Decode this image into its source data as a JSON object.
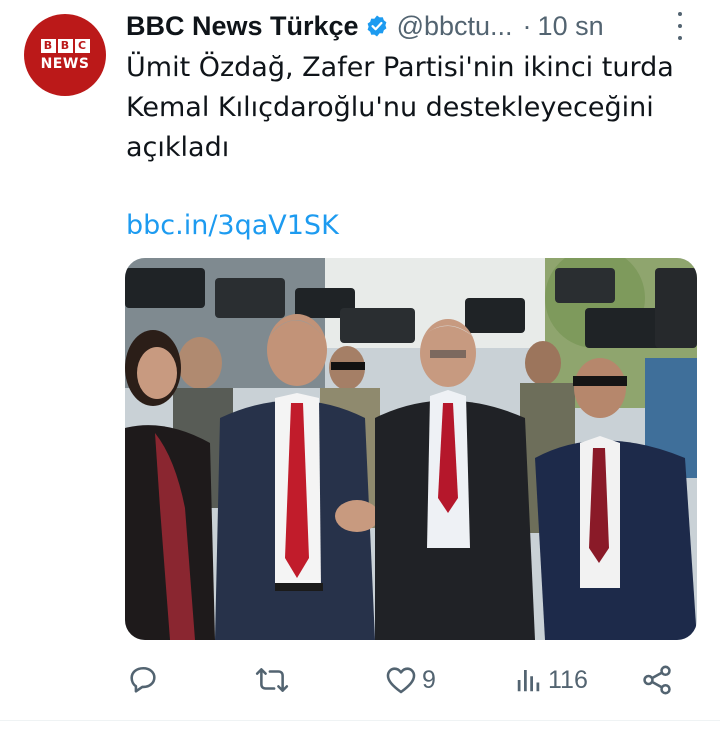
{
  "account": {
    "avatar_text_top": [
      "B",
      "B",
      "C"
    ],
    "avatar_text_bottom": "NEWS",
    "display_name": "BBC News Türkçe",
    "handle": "@bbctu...",
    "separator": "·",
    "time": "10 sn",
    "verified": true
  },
  "tweet": {
    "text": "Ümit Özdağ, Zafer Partisi'nin ikinci turda Kemal Kılıçdaroğlu'nu destekleyeceğini açıkladı",
    "link": "bbc.in/3qaV1SK"
  },
  "media": {
    "description_icon": "photo"
  },
  "actions": {
    "reply_count": "",
    "retweet_count": "",
    "like_count": "9",
    "views_count": "116"
  },
  "colors": {
    "brand_red": "#bb1919",
    "verified_blue": "#1d9bf0",
    "link_blue": "#1d9bf0",
    "muted": "#536471"
  }
}
